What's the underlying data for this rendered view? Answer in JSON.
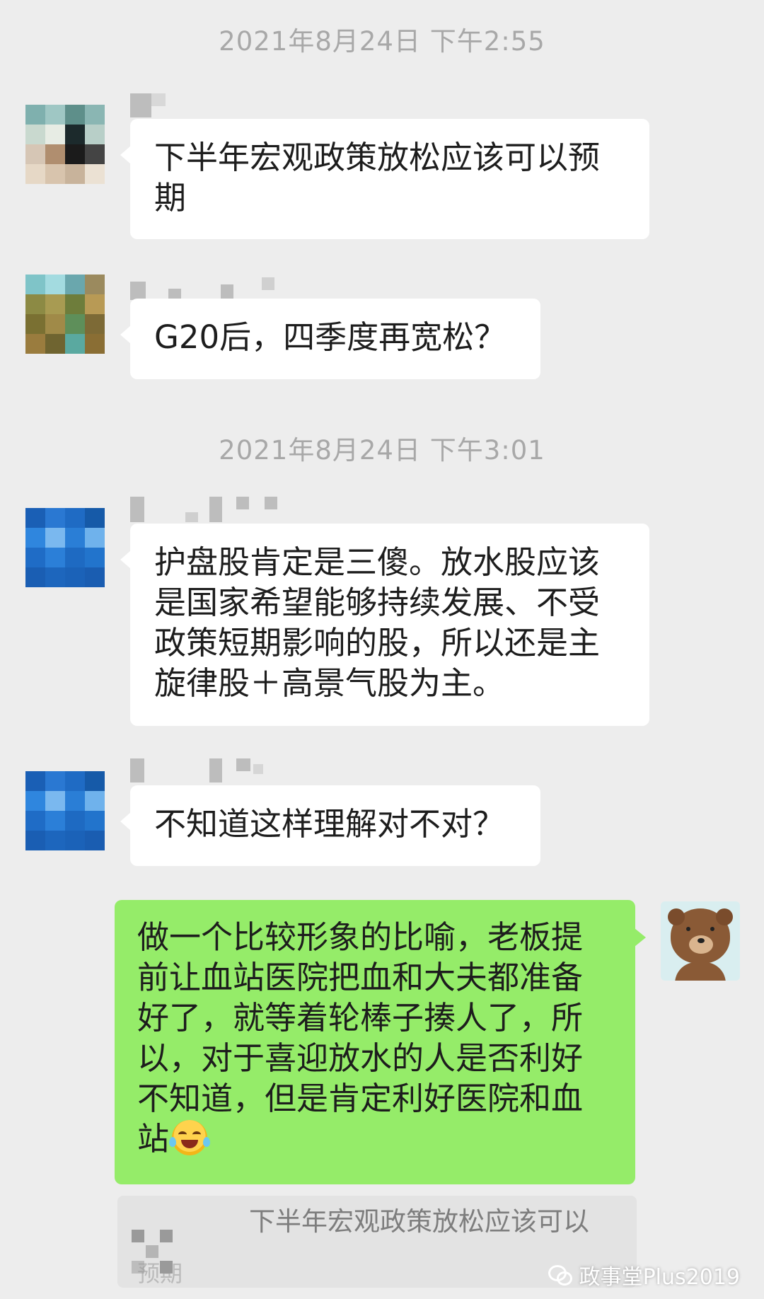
{
  "timestamps": [
    "2021年8月24日 下午2:55",
    "2021年8月24日 下午3:01"
  ],
  "messages": [
    {
      "side": "incoming",
      "text": "下半年宏观政策放松应该可以预期"
    },
    {
      "side": "incoming",
      "text": "G20后，四季度再宽松？"
    },
    {
      "side": "incoming",
      "text": "护盘股肯定是三傻。放水股应该是国家希望能够持续发展、不受政策短期影响的股，所以还是主旋律股＋高景气股为主。"
    },
    {
      "side": "incoming",
      "text": "不知道这样理解对不对？"
    },
    {
      "side": "outgoing",
      "text": "做一个比较形象的比喻，老板提前让血站医院把血和大夫都准备好了，就等着轮棒子揍人了，所以，对于喜迎放水的人是否利好不知道，但是肯定利好医院和血站",
      "emoji": "laughing-crying-emoji"
    }
  ],
  "quote": {
    "text": "下半年宏观政策放松应该可以",
    "tail": "预期"
  },
  "watermark": {
    "text": "政事堂Plus2019",
    "icon": "wechat-logo-icon"
  },
  "colors": {
    "background": "#ededed",
    "incoming_bubble": "#ffffff",
    "outgoing_bubble": "#95ec69",
    "timestamp": "#a8a8a8"
  }
}
